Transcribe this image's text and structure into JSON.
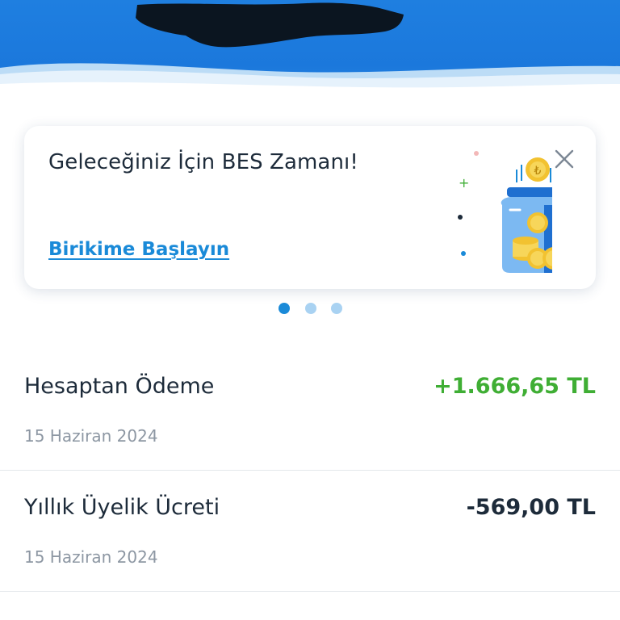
{
  "colors": {
    "header_blue": "#1b78dc",
    "accent_blue": "#1a8ad8",
    "positive_green": "#3fae34",
    "negative_navy": "#1d2b3a",
    "dot_active": "#1a8ad8",
    "dot_inactive": "#a9d2f2"
  },
  "promo": {
    "title": "Geleceğiniz İçin BES Zamanı!",
    "link_label": "Birikime Başlayın",
    "close_icon": "close-icon",
    "illustration": "coin-jar-illustration",
    "coin_symbol": "₺"
  },
  "pager": {
    "count": 3,
    "active_index": 0
  },
  "transactions": [
    {
      "title": "Hesaptan Ödeme",
      "date": "15 Haziran 2024",
      "amount": "+1.666,65 TL",
      "kind": "positive"
    },
    {
      "title": "Yıllık Üyelik Ücreti",
      "date": "15 Haziran 2024",
      "amount": "-569,00 TL",
      "kind": "negative"
    }
  ]
}
